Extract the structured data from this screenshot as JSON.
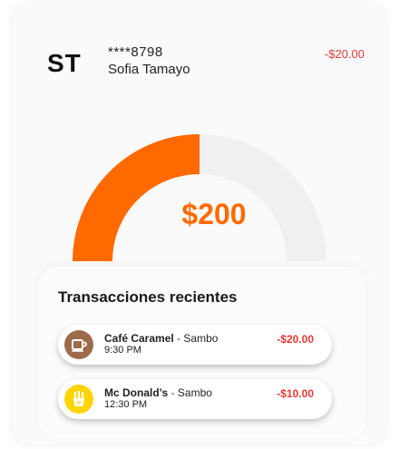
{
  "account": {
    "initials": "ST",
    "masked_number": "****8798",
    "holder_name": "Sofia Tamayo",
    "amount": "-$20.00"
  },
  "balance": {
    "display": "$200",
    "gauge_fill_fraction": 0.5,
    "gauge_color": "#ff6a00"
  },
  "recent": {
    "title": "Transacciones recientes",
    "items": [
      {
        "merchant": "Café Caramel",
        "separator": " - ",
        "location": "Sambo",
        "time": "9:30 PM",
        "amount": "-$20.00",
        "icon": "coffee-cup-icon",
        "icon_color": "#9c6b4a"
      },
      {
        "merchant": "Mc Donald’s",
        "separator": " - ",
        "location": "Sambo",
        "time": "12:30 PM",
        "amount": "-$10.00",
        "icon": "french-fries-icon",
        "icon_color": "#ffd400"
      }
    ]
  },
  "colors": {
    "negative": "#e53935",
    "accent": "#ff6a00"
  }
}
